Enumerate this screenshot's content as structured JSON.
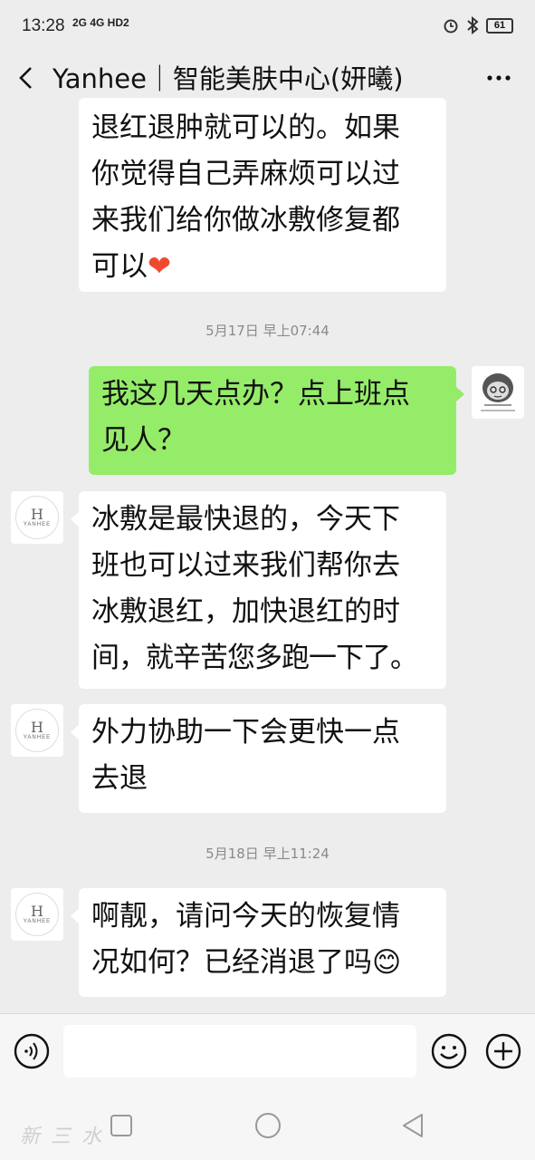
{
  "status_bar": {
    "time": "13:28",
    "network": "2G 4G HD2",
    "battery": "61"
  },
  "header": {
    "title": "Yanhee｜智能美肤中心(妍曦)"
  },
  "shop_avatar": {
    "letter": "H",
    "wordmark": "YANHEE"
  },
  "messages": [
    {
      "side": "in",
      "lines": [
        "退红退肿就可以的。如果",
        "你觉得自己弄麻烦可以过",
        "来我们给你做冰敷修复都",
        "可以"
      ],
      "emoji": "❤"
    },
    {
      "type": "time",
      "text": "5月17日 早上07:44"
    },
    {
      "side": "out",
      "lines": [
        "我这几天点办？点上班点",
        "见人？"
      ]
    },
    {
      "side": "in",
      "lines": [
        "冰敷是最快退的，今天下",
        "班也可以过来我们帮你去",
        "冰敷退红，加快退红的时",
        "间，就辛苦您多跑一下了。"
      ]
    },
    {
      "side": "in",
      "lines": [
        "外力协助一下会更快一点",
        "去退"
      ]
    },
    {
      "type": "time",
      "text": "5月18日 早上11:24"
    },
    {
      "side": "in",
      "lines": [
        "啊靓，请问今天的恢复情",
        "况如何？已经消退了吗"
      ],
      "emoji": "😊"
    }
  ],
  "input": {
    "value": "",
    "placeholder": ""
  },
  "watermark": "新三水"
}
